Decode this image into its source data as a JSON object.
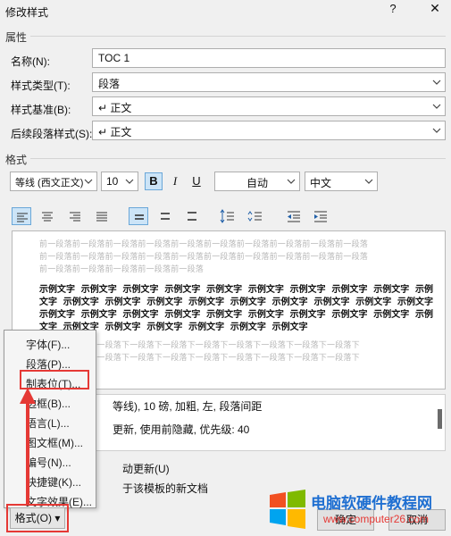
{
  "window": {
    "title": "修改样式",
    "help": "?",
    "close": "✕"
  },
  "properties": {
    "section": "属性",
    "name_label": "名称(N):",
    "name_value": "TOC 1",
    "type_label": "样式类型(T):",
    "type_value": "段落",
    "based_label": "样式基准(B):",
    "based_value": "↵ 正文",
    "next_label": "后续段落样式(S):",
    "next_value": "↵ 正文"
  },
  "format": {
    "section": "格式",
    "font": "等线 (西文正文)",
    "size": "10",
    "bold": "B",
    "italic": "I",
    "underline": "U",
    "color": "自动",
    "lang": "中文"
  },
  "preview": {
    "prev_lines": [
      "前一段落前一段落前一段落前一段落前一段落前一段落前一段落前一段落前一段落前一段落",
      "前一段落前一段落前一段落前一段落前一段落前一段落前一段落前一段落前一段落前一段落",
      "前一段落前一段落前一段落前一段落前一段落"
    ],
    "sample_lines": [
      "示例文字 示例文字 示例文字 示例文字 示例文字 示例文字 示例文字 示例文字 示例文字 示例",
      "文字 示例文字 示例文字 示例文字 示例文字 示例文字 示例文字 示例文字 示例文字 示例文字",
      "示例文字 示例文字 示例文字 示例文字 示例文字 示例文字 示例文字 示例文字 示例文字 示例",
      "文字 示例文字 示例文字 示例文字 示例文字 示例文字 示例文字"
    ],
    "next_lines": [
      "段落下一段落下一段落下一段落下一段落下一段落下一段落下一段落下一段落下一段落下",
      "段落下一段落下一段落下一段落下一段落下一段落下一段落下一段落下一段落下一段落下"
    ]
  },
  "description": {
    "line1": "等线), 10 磅, 加粗, 左, 段落间距",
    "line2": "更新, 使用前隐藏, 优先级: 40"
  },
  "options": {
    "auto_update": "动更新(U)",
    "new_docs": "于该模板的新文档"
  },
  "context_menu": {
    "items": [
      "字体(F)...",
      "段落(P)...",
      "制表位(T)...",
      "边框(B)...",
      "语言(L)...",
      "图文框(M)...",
      "编号(N)...",
      "快捷键(K)...",
      "文字效果(E)..."
    ]
  },
  "buttons": {
    "format": "格式(O) ▾",
    "ok": "确定",
    "cancel": "取消"
  },
  "watermark": {
    "title": "电脑软硬件教程网",
    "url": "www.computer26.com"
  },
  "colors": {
    "highlight": "#e53935",
    "accent": "#cce4f7",
    "brand_red": "#f25022",
    "brand_green": "#7fba00",
    "brand_blue": "#00a4ef",
    "brand_yellow": "#ffb900"
  }
}
